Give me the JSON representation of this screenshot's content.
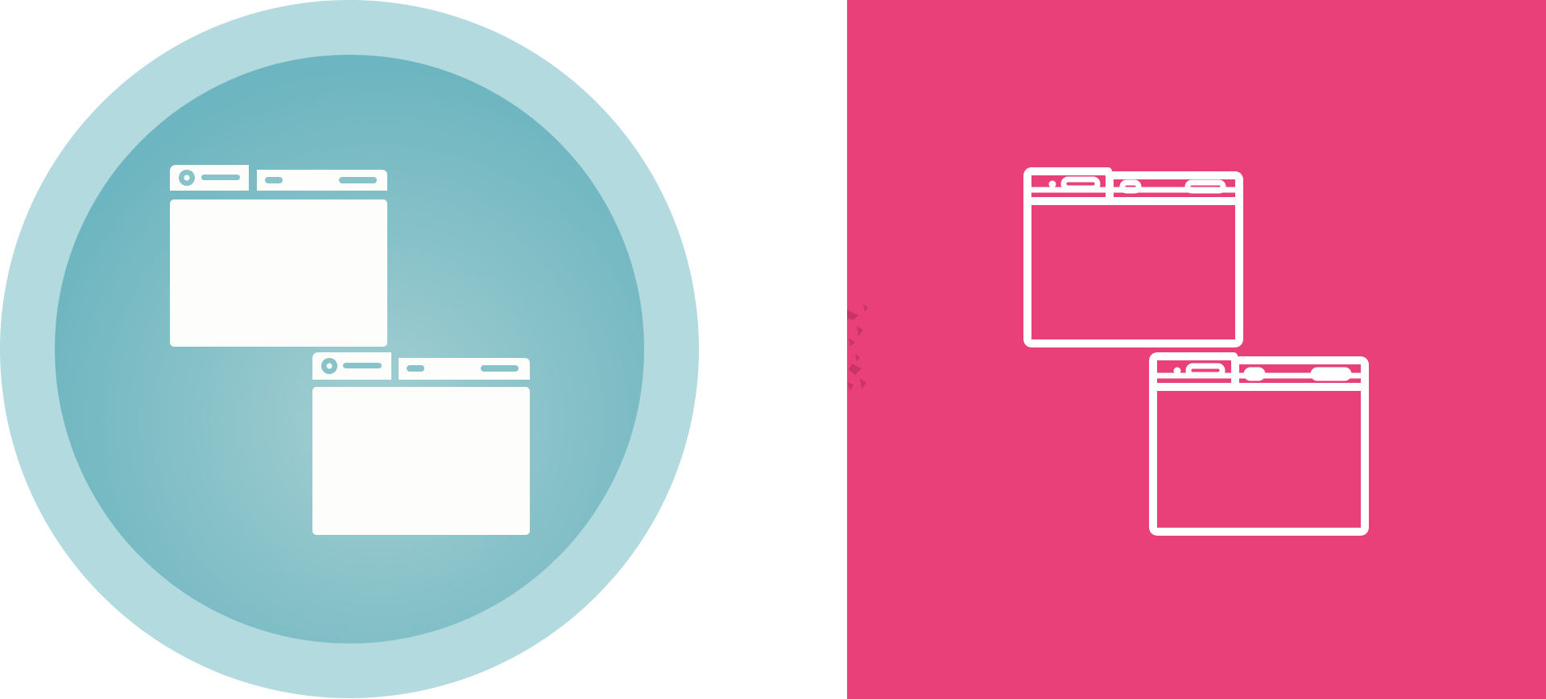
{
  "left_icon": {
    "name": "multiple-browser-windows-glyph-icon",
    "outer_ring_color": "#b3dadf",
    "inner_gradient_light": "#a4cfd2",
    "inner_gradient_dark": "#6db5c0",
    "glyph_color": "#fdfdfb"
  },
  "right_icon": {
    "name": "multiple-browser-windows-outline-icon",
    "background_color": "#ea407a",
    "stroke_color": "#ffffff"
  }
}
